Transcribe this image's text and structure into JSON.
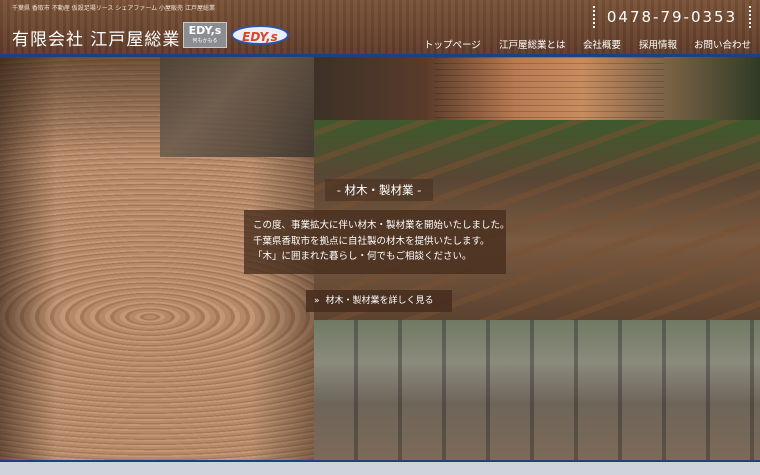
{
  "header": {
    "tagline": "千葉県 香取市 不動産 仮設足場リース シェアファーム 小屋販売 江戸屋総業",
    "logo_text": "有限会社 江戸屋総業",
    "badge1_main": "EDY,s",
    "badge1_sub": "何もかもる",
    "badge2_text": "EDY,s",
    "phone": "0478-79-0353",
    "colors": {
      "wood": "#6b4530",
      "accent_line": "#1f3f7e",
      "badge2_text": "#d6442c",
      "badge2_border": "#2f53a8"
    }
  },
  "nav": {
    "items": [
      {
        "label": "トップページ"
      },
      {
        "label": "江戸屋総業とは"
      },
      {
        "label": "会社概要"
      },
      {
        "label": "採用情報"
      },
      {
        "label": "お問い合わせ"
      }
    ]
  },
  "hero": {
    "section_title": "- 材木・製材業 -",
    "description_lines": [
      "この度、事業拡大に伴い材木・製材業を開始いたしました。",
      "千葉県香取市を拠点に自社製の材木を提供いたします。",
      "「木」に囲まれた暮らし・何でもご相談ください。"
    ],
    "cta_label": "材木・製材業を詳しく見る",
    "cta_icon": "double-chevron-right-icon"
  }
}
